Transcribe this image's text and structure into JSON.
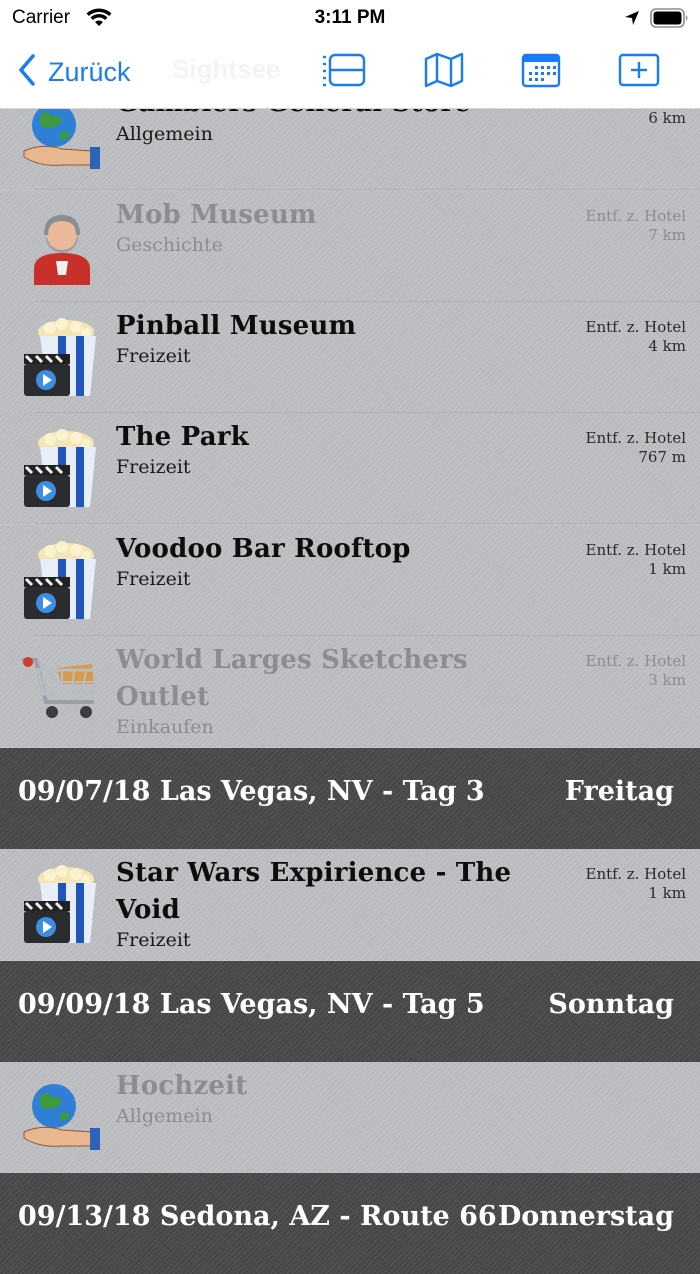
{
  "status_bar": {
    "carrier": "Carrier",
    "time": "3:11 PM"
  },
  "nav": {
    "back_label": "Zurück",
    "title": "Sightsee"
  },
  "rows": [
    {
      "title": "Gamblers General Store",
      "category": "Allgemein",
      "distance_label": "",
      "distance": "6 km",
      "icon": "globe-hand-icon",
      "dimmed": false
    },
    {
      "title": "Mob Museum",
      "category": "Geschichte",
      "distance_label": "Entf. z. Hotel",
      "distance": "7 km",
      "icon": "knight-icon",
      "dimmed": true
    },
    {
      "title": "Pinball Museum",
      "category": "Freizeit",
      "distance_label": "Entf. z. Hotel",
      "distance": "4 km",
      "icon": "popcorn-icon",
      "dimmed": false
    },
    {
      "title": "The Park",
      "category": "Freizeit",
      "distance_label": "Entf. z. Hotel",
      "distance": "767 m",
      "icon": "popcorn-icon",
      "dimmed": false
    },
    {
      "title": "Voodoo Bar Rooftop",
      "category": "Freizeit",
      "distance_label": "Entf. z. Hotel",
      "distance": "1 km",
      "icon": "popcorn-icon",
      "dimmed": false
    },
    {
      "title": "World Larges Sketchers Outlet",
      "category": "Einkaufen",
      "distance_label": "Entf. z. Hotel",
      "distance": "3 km",
      "icon": "shopping-cart-icon",
      "dimmed": true
    },
    {
      "title": "Star Wars Expirience - The Void",
      "category": "Freizeit",
      "distance_label": "Entf. z. Hotel",
      "distance": "1 km",
      "icon": "popcorn-icon",
      "dimmed": false
    },
    {
      "title": "Hochzeit",
      "category": "Allgemein",
      "distance_label": "",
      "distance": "",
      "icon": "globe-hand-icon",
      "dimmed": true
    }
  ],
  "headers": [
    {
      "title": "09/07/18 Las Vegas, NV - Tag 3",
      "day": "Freitag"
    },
    {
      "title": "09/09/18 Las Vegas, NV - Tag 5",
      "day": "Sonntag"
    },
    {
      "title": "09/13/18 Sedona, AZ - Route 66",
      "day": "Donnerstag"
    }
  ],
  "colors": {
    "accent": "#1a7cf5",
    "row_bg": "#c2c3c6",
    "header_bg": "#4b4c4e"
  }
}
